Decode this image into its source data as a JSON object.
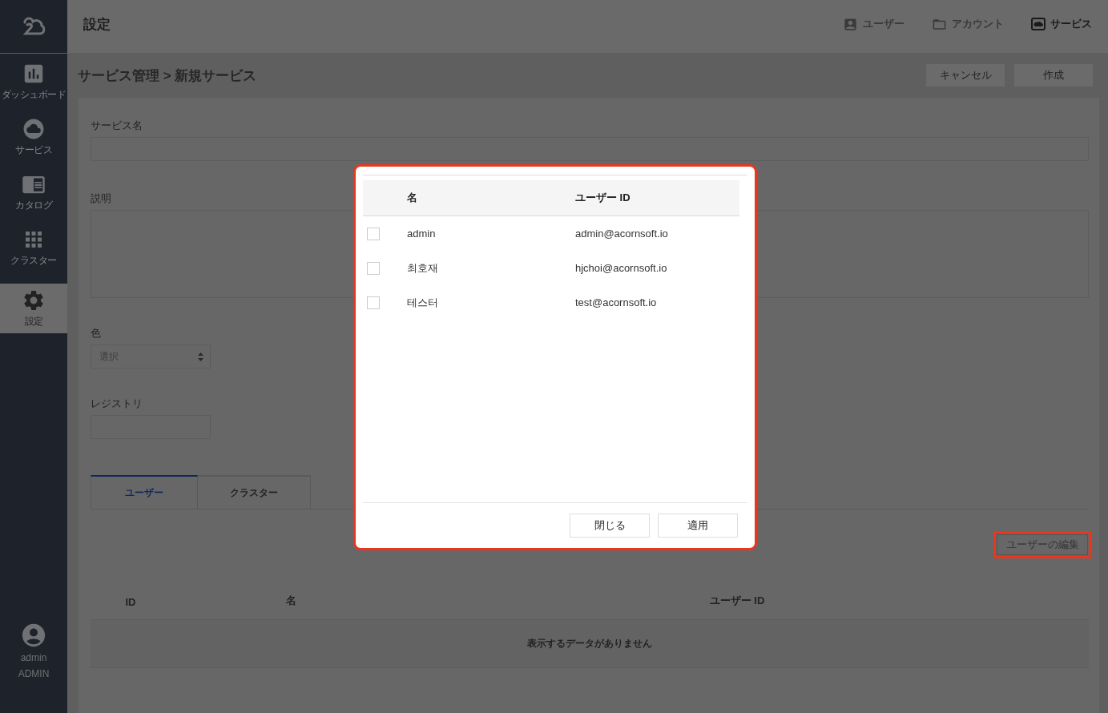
{
  "sidebar": {
    "items": [
      {
        "label": "ダッシュボード",
        "selected": false
      },
      {
        "label": "サービス",
        "selected": false
      },
      {
        "label": "カタログ",
        "selected": false
      },
      {
        "label": "クラスター",
        "selected": false
      },
      {
        "label": "設定",
        "selected": true
      }
    ],
    "user": {
      "name": "admin",
      "role": "ADMIN"
    }
  },
  "header": {
    "title": "設定",
    "nav": [
      {
        "label": "ユーザー",
        "selected": false
      },
      {
        "label": "アカウント",
        "selected": false
      },
      {
        "label": "サービス",
        "selected": true
      }
    ]
  },
  "breadcrumb": "サービス管理 > 新規サービス",
  "actions": [
    "キャンセル",
    "作成"
  ],
  "form": {
    "fields": [
      {
        "label": "サービス名",
        "kind": "text"
      },
      {
        "label": "説明",
        "kind": "textarea"
      },
      {
        "label": "色",
        "kind": "select",
        "value": "選択"
      },
      {
        "label": "レジストリ",
        "kind": "short"
      }
    ]
  },
  "tabs": [
    {
      "label": "ユーザー",
      "selected": true
    },
    {
      "label": "クラスター",
      "selected": false
    }
  ],
  "edit_button": {
    "label": "ユーザーの編集",
    "highlighted": true
  },
  "table": {
    "columns": [
      "ID",
      "名",
      "ユーザー ID"
    ],
    "empty_message": "表示するデータがありません"
  },
  "dialog": {
    "highlighted": true,
    "columns": [
      "名",
      "ユーザー ID"
    ],
    "rows": [
      {
        "name": "admin",
        "user_id": "admin@acornsoft.io",
        "checked": false
      },
      {
        "name": "최호재",
        "user_id": "hjchoi@acornsoft.io",
        "checked": false
      },
      {
        "name": "테스터",
        "user_id": "test@acornsoft.io",
        "checked": false
      }
    ],
    "buttons": [
      "閉じる",
      "適用"
    ]
  }
}
